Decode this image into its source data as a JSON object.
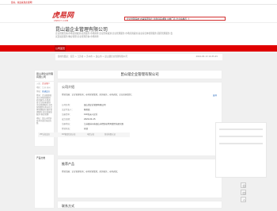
{
  "topbar": {
    "text": "您好，欢迎来到虎易网！"
  },
  "logo": {
    "main": "虎易网",
    "sub": "CNHUYI.COM"
  },
  "header": {
    "links": "企业管理系统 办事集团专栏 新建商品求购 主推厂商 企业站推荐 上"
  },
  "company": {
    "name": "昆山谐企业管理有限公司",
    "desc": "企业管理咨询;市场营销策划;商务服务;市场调查;企业形象策划;企业管理服务;市场营销策划;商业综合体管理服务;园区管理服务;会议及展览服务;物业管理;企业管理咨询;市场调查;"
  },
  "nav": {
    "tab": "公司首页"
  },
  "breadcrumb": {
    "path": "您的位置是：首页 > 江苏省 > 苏州市 > 昆山市 > 昆山谐企业管理有限公司",
    "date": "2024-05-13 10:35:45"
  },
  "sidebar": {
    "company_name": "昆山谐企业管理有限公司",
    "rows": [
      {
        "k": "入驻：",
        "v": "企业用户"
      },
      {
        "k": "地区：",
        "v": "江苏 苏州"
      },
      {
        "k": "等级：",
        "v": "普通会员",
        "link": true
      }
    ],
    "desc": "经营：企业管理咨询;市场营销策划;商务服务;市场调查;企业形象策划;企业管理服务;市场营销策划;商业综合体管理服务;园区管理服务;会议及展览服务;物业管理;",
    "address": "地址：昆山市经济技术开发区前进东路",
    "product_cat_title": "产品分类"
  },
  "main": {
    "title": "昆山谐企业管理有限公司",
    "intro": {
      "heading": "公司介绍",
      "summary": "经营范围：企业管理咨询；市场营销策划；商务服务；市场调查；企业形象策划；",
      "expand": "展开",
      "table": [
        {
          "k": "公司名称：",
          "v": "昆山谐企业管理有限公司"
        },
        {
          "k": "法定代表人：",
          "v": "陈晓燕"
        },
        {
          "k": "注册资本：",
          "v": "100万元人民币"
        },
        {
          "k": "成立日期：",
          "v": "2020-04-15"
        },
        {
          "k": "注册地址：",
          "v": "江苏省苏州市昆山市经济技术开发区前进东路"
        },
        {
          "k": "经营状态：",
          "v": "存续"
        }
      ],
      "flags": [
        "VIP认证会员",
        "ICP备案信息认证",
        "电话认证",
        "营业执照认证"
      ]
    },
    "products": {
      "heading": "推荐产品",
      "summary": "经营范围：企业管理咨询；市场营销策划；商务服务；市场调查；"
    },
    "contact": {
      "heading": "联系方式"
    }
  }
}
